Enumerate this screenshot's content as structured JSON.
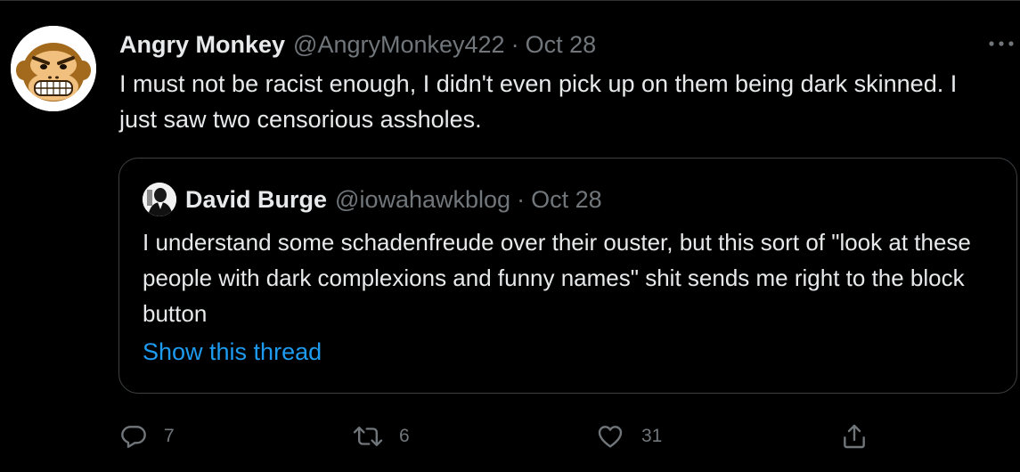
{
  "tweet": {
    "author_name": "Angry Monkey",
    "handle": "@AngryMonkey422",
    "separator": "·",
    "date": "Oct 28",
    "text": "I must not be racist enough, I didn't even pick up on them being dark skinned. I just saw two censorious assholes.",
    "avatar_icon": "angry-monkey-face-icon",
    "more_icon": "more-horizontal-icon"
  },
  "quoted": {
    "author_name": "David Burge",
    "handle": "@iowahawkblog",
    "separator": "·",
    "date": "Oct 28",
    "text": "I understand some schadenfreude over their ouster, but this sort of \"look at these people with dark complexions and funny names\" shit sends me right to the block button",
    "show_thread": "Show this thread",
    "avatar_icon": "portrait-photo-icon"
  },
  "actions": {
    "reply_count": "7",
    "retweet_count": "6",
    "like_count": "31",
    "icons": [
      "reply-icon",
      "retweet-icon",
      "like-icon",
      "share-icon"
    ]
  },
  "colors": {
    "background": "#000000",
    "text": "#e7e9ea",
    "muted": "#71767b",
    "link": "#1d9bf0",
    "border": "#3e4144",
    "monkey_fur": "#a36a1e",
    "monkey_face": "#f1c07e"
  }
}
